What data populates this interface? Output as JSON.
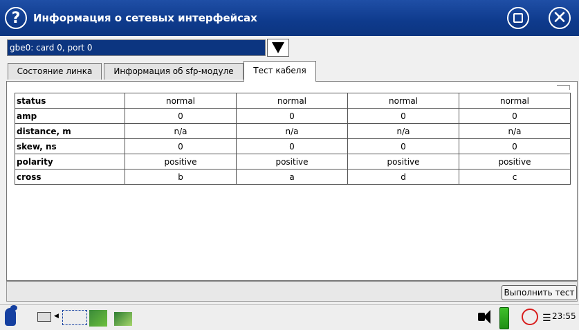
{
  "window": {
    "title": "Информация о сетевых интерфейсах",
    "help_glyph": "?"
  },
  "interface_select": {
    "value": "gbe0: card 0, port 0"
  },
  "tabs": [
    {
      "label": "Состояние линка",
      "active": false
    },
    {
      "label": "Информация об sfp-модуле",
      "active": false
    },
    {
      "label": "Тест кабеля",
      "active": true
    }
  ],
  "cable_test": {
    "rows": [
      {
        "label": "status",
        "values": [
          "normal",
          "normal",
          "normal",
          "normal"
        ]
      },
      {
        "label": "amp",
        "values": [
          "0",
          "0",
          "0",
          "0"
        ]
      },
      {
        "label": "distance, m",
        "values": [
          "n/a",
          "n/a",
          "n/a",
          "n/a"
        ]
      },
      {
        "label": "skew, ns",
        "values": [
          "0",
          "0",
          "0",
          "0"
        ]
      },
      {
        "label": "polarity",
        "values": [
          "positive",
          "positive",
          "positive",
          "positive"
        ]
      },
      {
        "label": "cross",
        "values": [
          "b",
          "a",
          "d",
          "c"
        ]
      }
    ]
  },
  "actions": {
    "run_test_label": "Выполнить тест"
  },
  "taskbar": {
    "clock": "23:55",
    "icons": [
      "app-logo-icon",
      "keyboard-icon",
      "network-icon",
      "network-card-icon",
      "network-card-2-icon",
      "speaker-icon",
      "battery-icon",
      "record-icon",
      "menu-icon"
    ]
  },
  "colors": {
    "titlebar": "#0e3a8c",
    "selection": "#0c3580",
    "battery": "#2aa61c",
    "record": "#d81e1e"
  }
}
